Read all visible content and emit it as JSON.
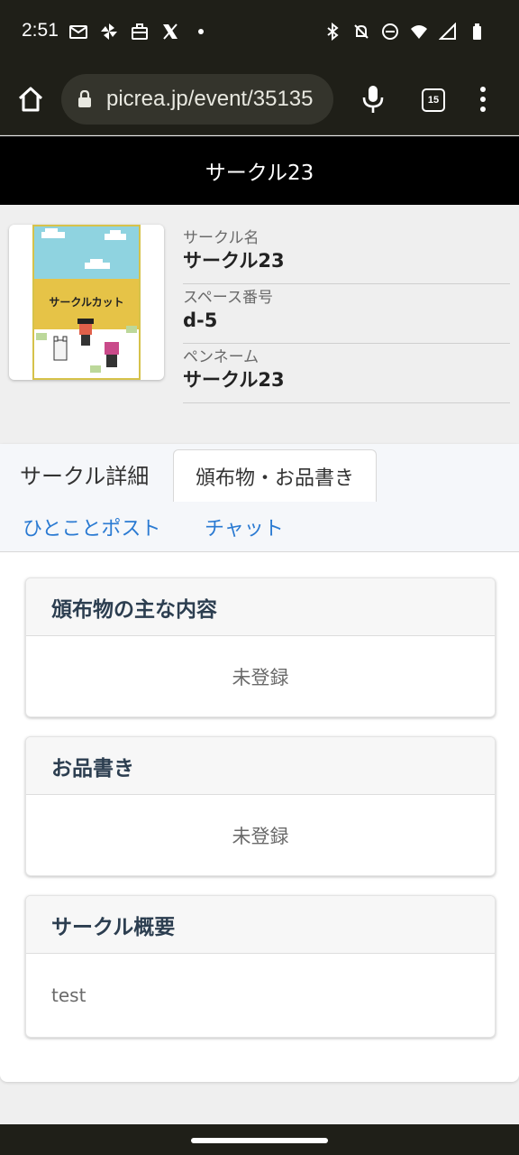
{
  "status_bar": {
    "time": "2:51",
    "left_icons": [
      "gmail-icon",
      "pinwheel-icon",
      "briefcase-icon",
      "x-logo-icon",
      "dot-icon"
    ],
    "right_icons": [
      "bluetooth-icon",
      "bell-off-icon",
      "do-not-disturb-icon",
      "wifi-icon",
      "signal-icon",
      "battery-icon"
    ]
  },
  "browser": {
    "url": "picrea.jp/event/35135",
    "tab_count": "15"
  },
  "header": {
    "title": "サークル23"
  },
  "profile": {
    "cut_text": "サークルカット",
    "rows": [
      {
        "label": "サークル名",
        "value": "サークル23"
      },
      {
        "label": "スペース番号",
        "value": "d-5"
      },
      {
        "label": "ペンネーム",
        "value": "サークル23"
      }
    ]
  },
  "tabs": {
    "detail": "サークル詳細",
    "items": "頒布物・お品書き",
    "post": "ひとことポスト",
    "chat": "チャット"
  },
  "cards": [
    {
      "title": "頒布物の主な内容",
      "body": "未登録"
    },
    {
      "title": "お品書き",
      "body": "未登録"
    },
    {
      "title": "サークル概要",
      "body": "test"
    }
  ],
  "colors": {
    "link": "#2a7ad2",
    "header_bg": "#000000",
    "chrome_bg": "#1f1f18"
  }
}
